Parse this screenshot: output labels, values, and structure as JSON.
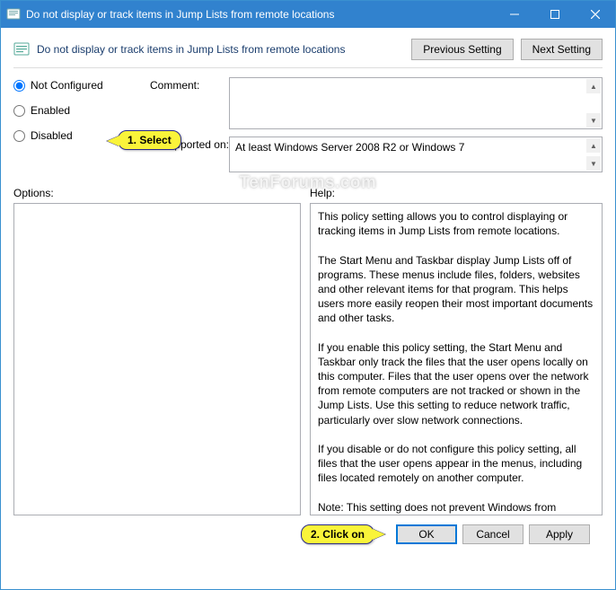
{
  "window": {
    "title": "Do not display or track items in Jump Lists from remote locations"
  },
  "header": {
    "policy_title": "Do not display or track items in Jump Lists from remote locations",
    "prev_btn": "Previous Setting",
    "next_btn": "Next Setting"
  },
  "radios": {
    "not_configured": "Not Configured",
    "enabled": "Enabled",
    "disabled": "Disabled"
  },
  "fields": {
    "comment_label": "Comment:",
    "comment_value": "",
    "supported_label": "Supported on:",
    "supported_value": "At least Windows Server 2008 R2 or Windows 7"
  },
  "panels": {
    "options_label": "Options:",
    "help_label": "Help:",
    "help_text": "This policy setting allows you to control displaying or tracking items in Jump Lists from remote locations.\n\nThe Start Menu and Taskbar display Jump Lists off of programs. These menus include files, folders, websites and other relevant items for that program. This helps users more easily reopen their most important documents and other tasks.\n\nIf you enable this policy setting, the Start Menu and Taskbar only track the files that the user opens locally on this computer. Files that the user opens over the network from remote computers are not tracked or shown in the Jump Lists. Use this setting to reduce network traffic, particularly over slow network connections.\n\nIf you disable or do not configure this policy setting, all files that the user opens appear in the menus, including files located remotely on another computer.\n\nNote: This setting does not prevent Windows from displaying remote files that the user has explicitly pinned to the Jump Lists. See the \"\"Do not allow pinning items in Jump Lists\"\" policy setting."
  },
  "footer": {
    "ok": "OK",
    "cancel": "Cancel",
    "apply": "Apply"
  },
  "annotations": {
    "step1": "1. Select",
    "step2": "2. Click on"
  },
  "watermark": "TenForums.com"
}
